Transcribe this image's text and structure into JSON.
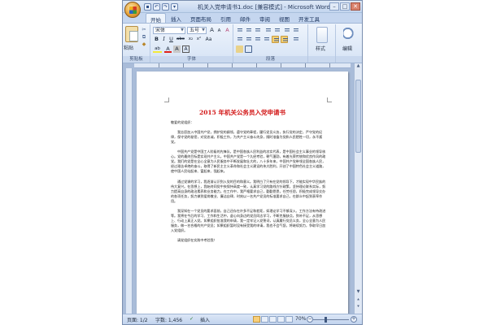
{
  "window": {
    "title": "机关入党申请书1.doc [兼容模式] - Microsoft Word",
    "controls": {
      "minimize": "–",
      "maximize": "□",
      "close": "✕"
    }
  },
  "qat": {
    "save": "▪",
    "undo": "↶",
    "redo": "↷",
    "more": "▾"
  },
  "ribbon": {
    "tabs": [
      "开始",
      "插入",
      "页面布局",
      "引用",
      "邮件",
      "审阅",
      "视图",
      "开发工具"
    ],
    "active_tab": "开始",
    "clipboard": {
      "paste": "粘贴",
      "group": "剪贴板",
      "cut": "✂",
      "copy": "⧉",
      "painter": "🖌"
    },
    "font": {
      "group": "字体",
      "font_name": "宋体",
      "font_size": "五号",
      "grow": "A",
      "shrink": "A",
      "clear": "A",
      "bold": "B",
      "italic": "I",
      "underline": "U",
      "strike": "abc",
      "sub": "x₂",
      "sup": "x²",
      "change_case": "Aa",
      "highlight": "ab",
      "font_color": "A",
      "char_shade": "A"
    },
    "paragraph": {
      "group": "段落"
    },
    "styles": {
      "style": "样式",
      "edit": "编辑"
    }
  },
  "document": {
    "title": "2015 年机关公务员入党申请书",
    "paragraphs": [
      "敬爱的党组织：",
      "我志愿加入中国共产党，拥护党的纲领，遵守党的章程，履行党员义务，执行党的决定，严守党的纪律，保守党的秘密，对党忠诚，积极工作，为共产主义奋斗终身，随时准备为党和人民牺牲一切，永不叛党。",
      "中国共产党是中国工人阶级的先锋队，是中国各族人民利益的忠实代表，是中国社会主义事业的领导核心。党的最终目标是实现共产主义。中国共产党是一个久经考验，朝气蓬勃，有着光荣传统和优良作风的政党。我们的党是在全心全意为人民服务中不断发展和壮大的，八十多年来，中国共产党带领全国各族人民，经过艰苦卓绝的奋斗，取得了新民主主义革命和社会主义建设的伟大胜利，开创了中国特色社会主义道路，使中国人民站起来、富起来、强起来。",
      "通过党课的学习，我逐渐认识到入党的目的和意义。我明白了只有在党的领导下，才能实现中华民族的伟大复兴。在思想上，我始终同党中央保持高度一致，认真学习党的路线方针政策，坚持理论联系实际，努力提高自身的政治素养和业务能力。在工作中，我严格要求自己，勤勤恳恳，任劳任怨，积极完成领导交办的各项任务，努力做到爱岗敬业、廉洁自律，时刻以一名共产党员的标准要求自己，在群众中起到表率作用。",
      "我深知在一个党员的要求面前，自己还存在许多不足和差距，如理论学习不够深入、工作方法有待改进等。我将在今后的学习、工作和生活中，虚心向身边的党员同志学习，不断克服缺点，弥补不足，从思想上、行动上真正入党。如果组织批准我的申请，我一定牢记入党誓词，认真履行党员义务，全心全意为人民服务，做一名合格的共产党员；如果组织暂时没有接受我的申请，我也不会气馁，将继续努力，争取早日加入党组织。",
      "请党组织在实践中考验我！"
    ]
  },
  "status": {
    "page": "页面: 1/2",
    "words": "字数: 1,456",
    "check": "✓",
    "insert": "插入",
    "zoom": "70%",
    "zoom_minus": "−",
    "zoom_plus": "+",
    "zoom_level": 0.7
  }
}
